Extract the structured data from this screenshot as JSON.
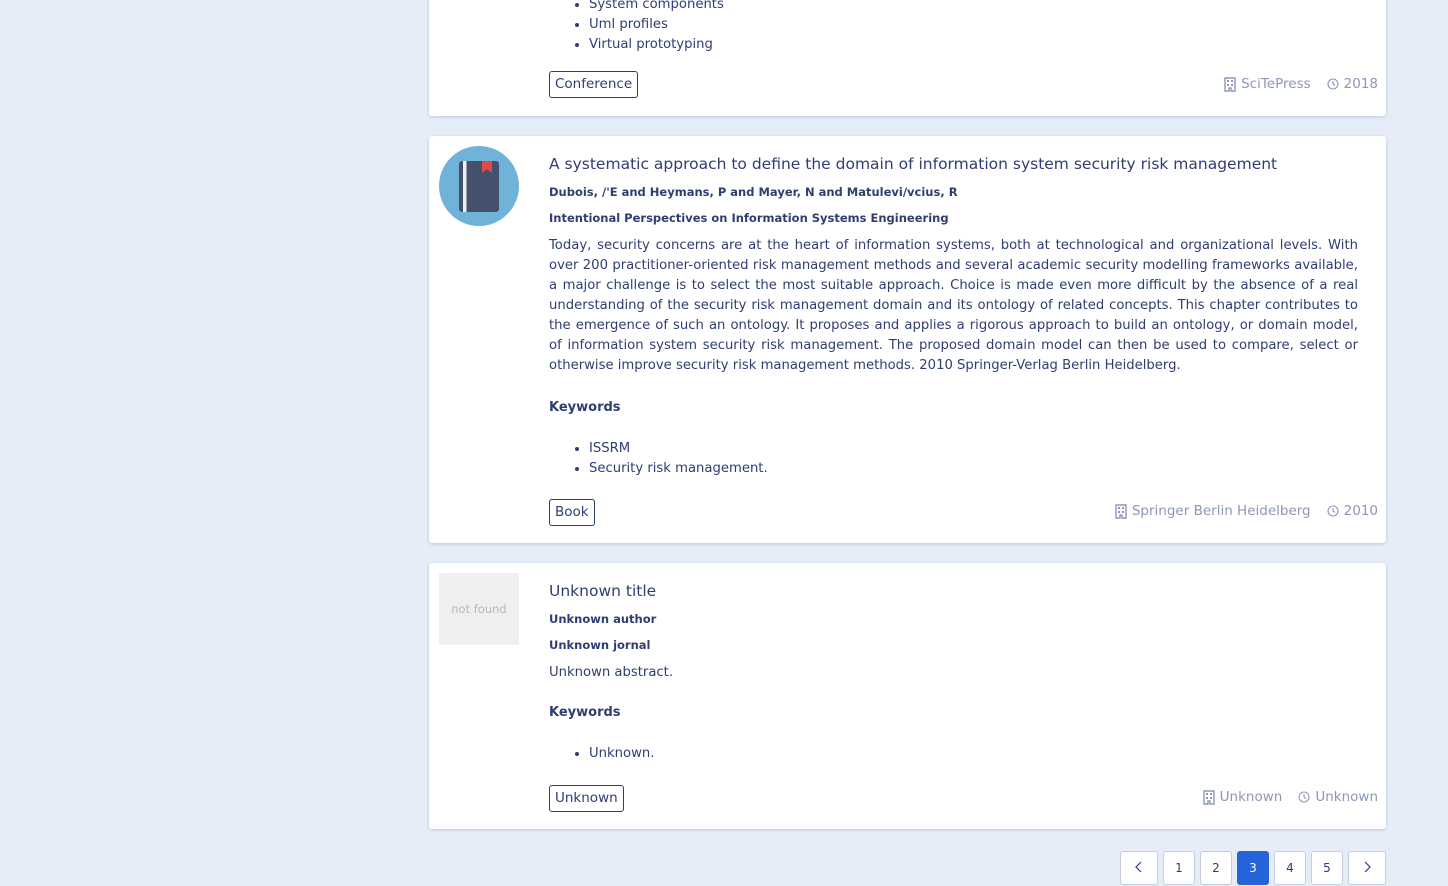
{
  "entries": [
    {
      "keywords": [
        "System components",
        "Uml profiles",
        "Virtual prototyping"
      ],
      "type": "Conference",
      "publisher": "SciTePress",
      "year": "2018"
    },
    {
      "thumbnail_icon": "book-icon",
      "title": "A systematic approach to define the domain of information system security risk management",
      "authors": "Dubois, /'E and Heymans, P and Mayer, N and Matulevi/vcius, R",
      "journal": "Intentional Perspectives on Information Systems Engineering",
      "abstract": "Today, security concerns are at the heart of information systems, both at technological and organizational levels. With over 200 practitioner-oriented risk management methods and several academic security modelling frameworks available, a major challenge is to select the most suitable approach. Choice is made even more difficult by the absence of a real understanding of the security risk management domain and its ontology of related concepts. This chapter contributes to the emergence of such an ontology. It proposes and applies a rigorous approach to build an ontology, or domain model, of information system security risk management. The proposed domain model can then be used to compare, select or otherwise improve security risk management methods. 2010 Springer-Verlag Berlin Heidelberg.",
      "keywords_heading": "Keywords",
      "keywords": [
        "ISSRM",
        "Security risk management."
      ],
      "type": "Book",
      "publisher": "Springer Berlin Heidelberg",
      "year": "2010"
    },
    {
      "thumbnail_text": "not found",
      "title": "Unknown title",
      "authors": "Unknown author",
      "journal": "Unknown jornal",
      "abstract": "Unknown abstract.",
      "keywords_heading": "Keywords",
      "keywords": [
        "Unknown."
      ],
      "type": "Unknown",
      "publisher": "Unknown",
      "year": "Unknown"
    }
  ],
  "pagination": {
    "prev_icon": "chevron-left-icon",
    "next_icon": "chevron-right-icon",
    "pages": [
      "1",
      "2",
      "3",
      "4",
      "5"
    ],
    "current": "3"
  },
  "colors": {
    "background": "#e7edf8",
    "text": "#2f3e72",
    "muted": "#8d96b8",
    "active_page": "#2563d9",
    "book_circle": "#6fb3d9"
  }
}
